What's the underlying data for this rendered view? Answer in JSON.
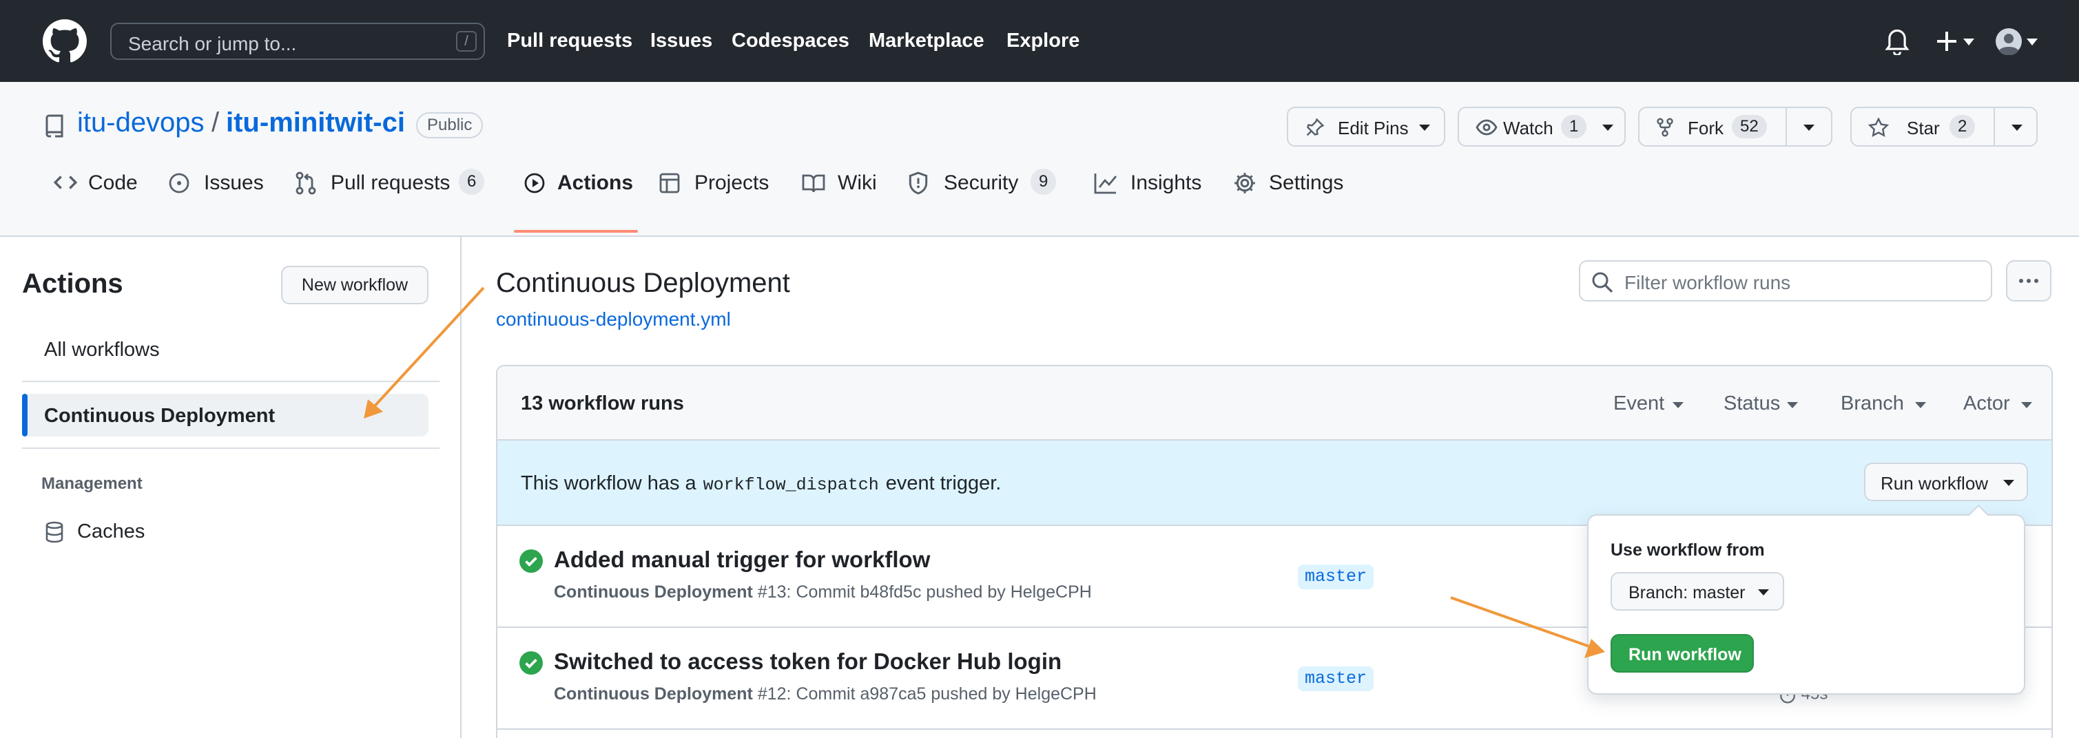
{
  "header": {
    "search_placeholder": "Search or jump to...",
    "search_shortcut": "/",
    "nav": [
      "Pull requests",
      "Issues",
      "Codespaces",
      "Marketplace",
      "Explore"
    ]
  },
  "repo": {
    "owner": "itu-devops",
    "separator": "/",
    "name": "itu-minitwit-ci",
    "visibility": "Public",
    "edit_pins_label": "Edit Pins",
    "watch_label": "Watch",
    "watch_count": "1",
    "fork_label": "Fork",
    "fork_count": "52",
    "star_label": "Star",
    "star_count": "2"
  },
  "tabs": [
    {
      "label": "Code",
      "icon": "code-icon"
    },
    {
      "label": "Issues",
      "icon": "issue-icon"
    },
    {
      "label": "Pull requests",
      "icon": "pull-request-icon",
      "count": "6"
    },
    {
      "label": "Actions",
      "icon": "play-icon",
      "selected": true
    },
    {
      "label": "Projects",
      "icon": "table-icon"
    },
    {
      "label": "Wiki",
      "icon": "book-icon"
    },
    {
      "label": "Security",
      "icon": "shield-icon",
      "count": "9"
    },
    {
      "label": "Insights",
      "icon": "graph-icon"
    },
    {
      "label": "Settings",
      "icon": "gear-icon"
    }
  ],
  "sidebar": {
    "title": "Actions",
    "new_workflow_label": "New workflow",
    "all_workflows_label": "All workflows",
    "selected_workflow_label": "Continuous Deployment",
    "management_heading": "Management",
    "caches_label": "Caches"
  },
  "workflow": {
    "title": "Continuous Deployment",
    "file": "continuous-deployment.yml",
    "filter_placeholder": "Filter workflow runs",
    "runs_count_label": "13 workflow runs",
    "filters": [
      "Event",
      "Status",
      "Branch",
      "Actor"
    ],
    "dispatch_prefix": "This workflow has a",
    "dispatch_code": "workflow_dispatch",
    "dispatch_suffix": "event trigger.",
    "run_workflow_label": "Run workflow",
    "runs": [
      {
        "title": "Added manual trigger for workflow",
        "workflow": "Continuous Deployment",
        "meta": "#13: Commit b48fd5c pushed by HelgeCPH",
        "branch": "master",
        "status": "success"
      },
      {
        "title": "Switched to access token for Docker Hub login",
        "workflow": "Continuous Deployment",
        "meta": "#12: Commit a987ca5 pushed by HelgeCPH",
        "branch": "master",
        "status": "success",
        "duration": "45s"
      }
    ]
  },
  "popover": {
    "heading": "Use workflow from",
    "branch_select_label": "Branch: master",
    "run_button_label": "Run workflow"
  },
  "colors": {
    "header_bg": "#24292f",
    "link": "#0969da",
    "success": "#2da44e",
    "annotation_arrow": "#f0983a",
    "tab_underline": "#fd8c73"
  }
}
